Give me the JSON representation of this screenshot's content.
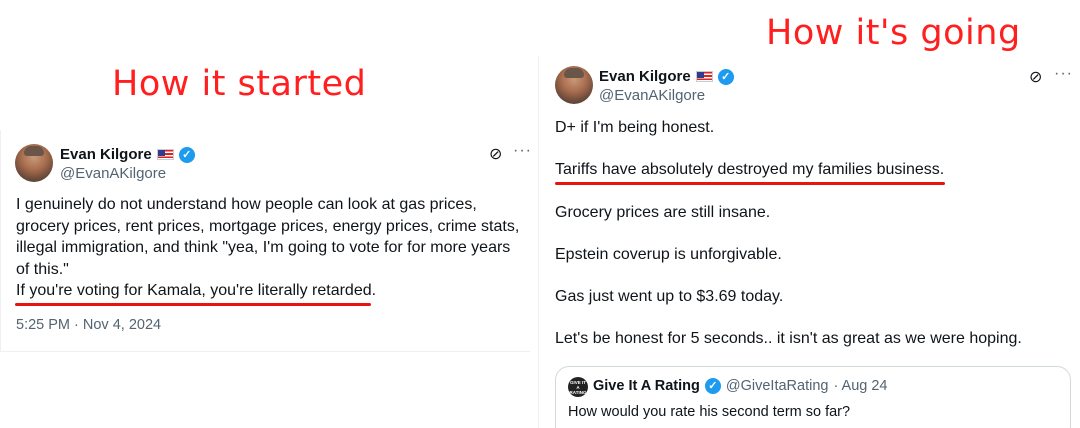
{
  "captions": {
    "left": "How it started",
    "right": "How it's going"
  },
  "colors": {
    "caption": "#ff1f1f",
    "underline": "#e8140f",
    "verified": "#1d9bf0",
    "secondary_text": "#536471"
  },
  "left_tweet": {
    "author_name": "Evan Kilgore",
    "author_handle": "@EvanAKilgore",
    "icons": [
      "us-flag-icon",
      "verified-badge-icon",
      "grok-icon",
      "more-options-icon"
    ],
    "body": "I genuinely do not understand how people can look at gas prices, grocery prices, rent prices, mortgage prices, energy prices, crime stats, illegal immigration, and think \"yea, I'm going to vote for for more years of this.\"",
    "highlighted_line": "If you're voting for Kamala, you're literally retarded.",
    "timestamp": "5:25 PM · Nov 4, 2024"
  },
  "right_tweet": {
    "author_name": "Evan Kilgore",
    "author_handle": "@EvanAKilgore",
    "icons": [
      "us-flag-icon",
      "verified-badge-icon",
      "grok-icon",
      "more-options-icon"
    ],
    "lines": [
      "D+ if I'm being honest.",
      "Tariffs have absolutely destroyed my families business.",
      "Grocery prices are still insane.",
      "Epstein coverup is unforgivable.",
      "Gas just went up to $3.69 today.",
      "Let's be honest for 5 seconds.. it isn't as great as we were hoping."
    ],
    "quoted_tweet": {
      "avatar_text": "GIVE IT A RATING",
      "author_name": "Give It A Rating",
      "author_handle": "@GiveItaRating",
      "date": "· Aug 24",
      "text": "How would you rate his second term so far?"
    }
  }
}
